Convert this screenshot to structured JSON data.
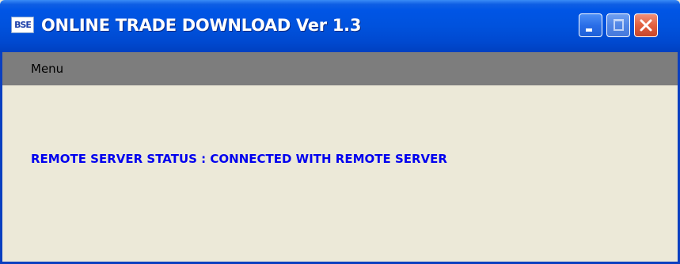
{
  "window": {
    "title": "ONLINE TRADE DOWNLOAD Ver 1.3",
    "icon_label": "BSE",
    "icon": "app-icon"
  },
  "caption_buttons": {
    "minimize_icon": "minimize-icon",
    "maximize_icon": "maximize-icon",
    "close_icon": "close-icon"
  },
  "menubar": {
    "items": [
      {
        "label": "Menu"
      }
    ]
  },
  "main": {
    "status_text": "REMOTE SERVER STATUS : CONNECTED WITH REMOTE SERVER"
  },
  "colors": {
    "titlebar": "#0055e5",
    "menubar": "#7d7d7d",
    "background": "#ece9d8",
    "status_text": "#0000ee",
    "close_button": "#e2603e"
  }
}
